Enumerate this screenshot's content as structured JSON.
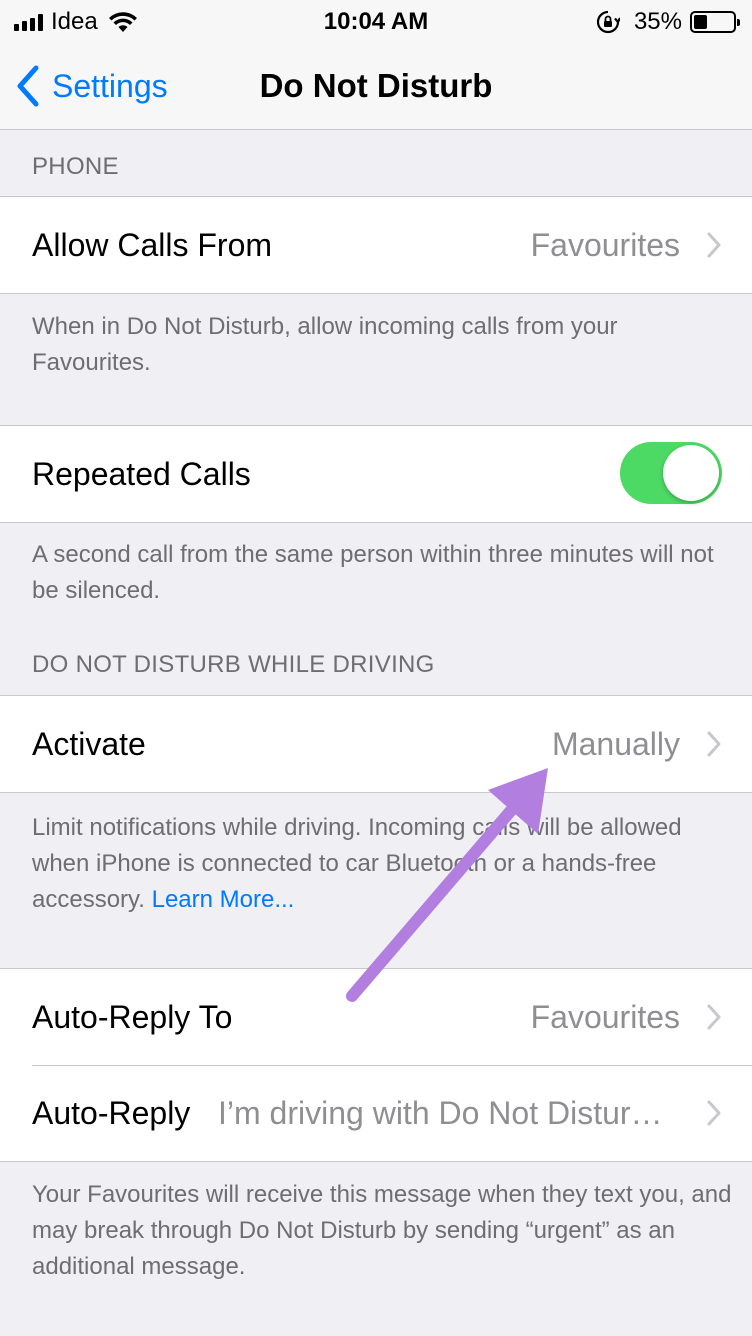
{
  "status_bar": {
    "carrier": "Idea",
    "time": "10:04 AM",
    "battery_percent": "35%",
    "battery_level": 0.35
  },
  "nav": {
    "back_label": "Settings",
    "title": "Do Not Disturb"
  },
  "phone_section": {
    "header": "PHONE",
    "allow_calls": {
      "label": "Allow Calls From",
      "value": "Favourites"
    },
    "allow_calls_footer": "When in Do Not Disturb, allow incoming calls from your Favourites.",
    "repeated_calls": {
      "label": "Repeated Calls",
      "enabled": true
    },
    "repeated_calls_footer": "A second call from the same person within three minutes will not be silenced."
  },
  "driving_section": {
    "header": "DO NOT DISTURB WHILE DRIVING",
    "activate": {
      "label": "Activate",
      "value": "Manually"
    },
    "activate_footer": "Limit notifications while driving. Incoming calls will be allowed when iPhone is connected to car Bluetooth or a hands-free accessory.",
    "learn_more": "Learn More...",
    "auto_reply_to": {
      "label": "Auto-Reply To",
      "value": "Favourites"
    },
    "auto_reply": {
      "label": "Auto-Reply",
      "value": "I’m driving with Do Not Disturb While Driving turned on. I’ll see your message when I get where I’m going."
    },
    "auto_reply_footer": "Your Favourites will receive this message when they text you, and may break through Do Not Disturb by sending “urgent” as an additional message."
  },
  "colors": {
    "accent": "#007aff",
    "toggle_on": "#4cd964",
    "annotation_arrow": "#b27ee0"
  }
}
